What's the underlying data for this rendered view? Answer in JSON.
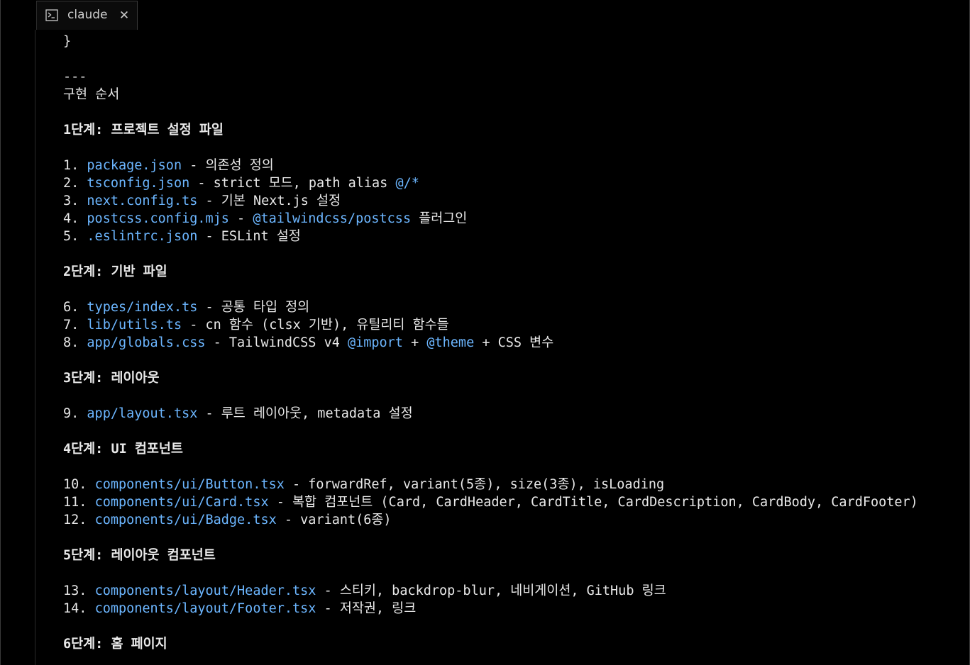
{
  "tab": {
    "label": "claude",
    "close_glyph": "✕",
    "icon": "terminal-icon"
  },
  "colors": {
    "background": "#000000",
    "text": "#e8e8e8",
    "link": "#6cb6ff"
  },
  "lines": [
    {
      "type": "text",
      "segments": [
        {
          "t": "}"
        }
      ]
    },
    {
      "type": "blank"
    },
    {
      "type": "text",
      "segments": [
        {
          "t": "---"
        }
      ]
    },
    {
      "type": "text",
      "segments": [
        {
          "t": "구현 순서"
        }
      ]
    },
    {
      "type": "blank"
    },
    {
      "type": "text",
      "segments": [
        {
          "t": "1단계: 프로젝트 설정 파일",
          "style": "heading"
        }
      ]
    },
    {
      "type": "blank"
    },
    {
      "type": "text",
      "segments": [
        {
          "t": "1. "
        },
        {
          "t": "package.json",
          "style": "link"
        },
        {
          "t": " - 의존성 정의"
        }
      ]
    },
    {
      "type": "text",
      "segments": [
        {
          "t": "2. "
        },
        {
          "t": "tsconfig.json",
          "style": "link"
        },
        {
          "t": " - strict 모드, path alias "
        },
        {
          "t": "@/*",
          "style": "link"
        }
      ]
    },
    {
      "type": "text",
      "segments": [
        {
          "t": "3. "
        },
        {
          "t": "next.config.ts",
          "style": "link"
        },
        {
          "t": " - 기본 Next.js 설정"
        }
      ]
    },
    {
      "type": "text",
      "segments": [
        {
          "t": "4. "
        },
        {
          "t": "postcss.config.mjs",
          "style": "link"
        },
        {
          "t": " - "
        },
        {
          "t": "@tailwindcss/postcss",
          "style": "link"
        },
        {
          "t": " 플러그인"
        }
      ]
    },
    {
      "type": "text",
      "segments": [
        {
          "t": "5. "
        },
        {
          "t": ".eslintrc.json",
          "style": "link"
        },
        {
          "t": " - ESLint 설정"
        }
      ]
    },
    {
      "type": "blank"
    },
    {
      "type": "text",
      "segments": [
        {
          "t": "2단계: 기반 파일",
          "style": "heading"
        }
      ]
    },
    {
      "type": "blank"
    },
    {
      "type": "text",
      "segments": [
        {
          "t": "6. "
        },
        {
          "t": "types/index.ts",
          "style": "link"
        },
        {
          "t": " - 공통 타입 정의"
        }
      ]
    },
    {
      "type": "text",
      "segments": [
        {
          "t": "7. "
        },
        {
          "t": "lib/utils.ts",
          "style": "link"
        },
        {
          "t": " - cn 함수 (clsx 기반), 유틸리티 함수들"
        }
      ]
    },
    {
      "type": "text",
      "segments": [
        {
          "t": "8. "
        },
        {
          "t": "app/globals.css",
          "style": "link"
        },
        {
          "t": " - TailwindCSS v4 "
        },
        {
          "t": "@import",
          "style": "link"
        },
        {
          "t": " + "
        },
        {
          "t": "@theme",
          "style": "link"
        },
        {
          "t": " + CSS 변수"
        }
      ]
    },
    {
      "type": "blank"
    },
    {
      "type": "text",
      "segments": [
        {
          "t": "3단계: 레이아웃",
          "style": "heading"
        }
      ]
    },
    {
      "type": "blank"
    },
    {
      "type": "text",
      "segments": [
        {
          "t": "9. "
        },
        {
          "t": "app/layout.tsx",
          "style": "link"
        },
        {
          "t": " - 루트 레이아웃, metadata 설정"
        }
      ]
    },
    {
      "type": "blank"
    },
    {
      "type": "text",
      "segments": [
        {
          "t": "4단계: UI 컴포넌트",
          "style": "heading"
        }
      ]
    },
    {
      "type": "blank"
    },
    {
      "type": "text",
      "segments": [
        {
          "t": "10. "
        },
        {
          "t": "components/ui/Button.tsx",
          "style": "link"
        },
        {
          "t": " - forwardRef, variant(5종), size(3종), isLoading"
        }
      ]
    },
    {
      "type": "text",
      "segments": [
        {
          "t": "11. "
        },
        {
          "t": "components/ui/Card.tsx",
          "style": "link"
        },
        {
          "t": " - 복합 컴포넌트 (Card, CardHeader, CardTitle, CardDescription, CardBody, CardFooter)"
        }
      ]
    },
    {
      "type": "text",
      "segments": [
        {
          "t": "12. "
        },
        {
          "t": "components/ui/Badge.tsx",
          "style": "link"
        },
        {
          "t": " - variant(6종)"
        }
      ]
    },
    {
      "type": "blank"
    },
    {
      "type": "text",
      "segments": [
        {
          "t": "5단계: 레이아웃 컴포넌트",
          "style": "heading"
        }
      ]
    },
    {
      "type": "blank"
    },
    {
      "type": "text",
      "segments": [
        {
          "t": "13. "
        },
        {
          "t": "components/layout/Header.tsx",
          "style": "link"
        },
        {
          "t": " - 스티키, backdrop-blur, 네비게이션, GitHub 링크"
        }
      ]
    },
    {
      "type": "text",
      "segments": [
        {
          "t": "14. "
        },
        {
          "t": "components/layout/Footer.tsx",
          "style": "link"
        },
        {
          "t": " - 저작권, 링크"
        }
      ]
    },
    {
      "type": "blank"
    },
    {
      "type": "text",
      "segments": [
        {
          "t": "6단계: 홈 페이지",
          "style": "heading"
        }
      ]
    }
  ]
}
